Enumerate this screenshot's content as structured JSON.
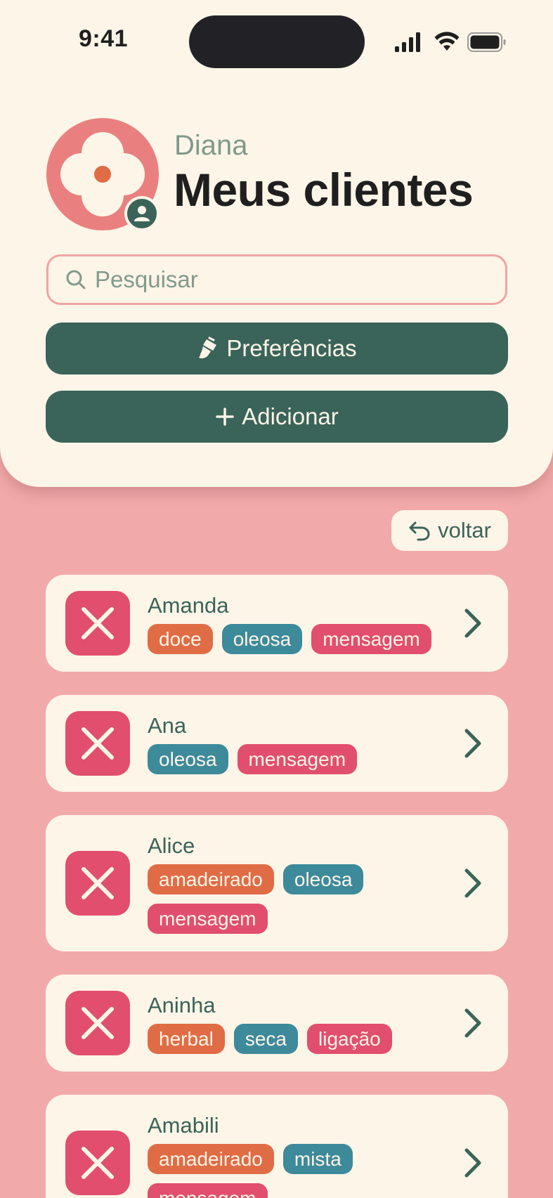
{
  "status_bar": {
    "time": "9:41"
  },
  "profile": {
    "user_name": "Diana"
  },
  "header": {
    "title": "Meus clientes"
  },
  "search": {
    "placeholder": "Pesquisar",
    "value": ""
  },
  "actions": {
    "preferences_label": "Preferências",
    "add_label": "Adicionar"
  },
  "back": {
    "label": "voltar"
  },
  "colors": {
    "background": "#F2A9AA",
    "card": "#FDF5E8",
    "primary": "#3A6459",
    "remove": "#E14E6E",
    "tag_orange": "#E06C45",
    "tag_teal": "#3D8A9B",
    "tag_pink": "#E14E6E",
    "avatar": "#E9807F"
  },
  "clients": [
    {
      "name": "Amanda",
      "tags": [
        {
          "label": "doce",
          "color": "#E06C45"
        },
        {
          "label": "oleosa",
          "color": "#3D8A9B"
        },
        {
          "label": "mensagem",
          "color": "#E14E6E"
        }
      ]
    },
    {
      "name": "Ana",
      "tags": [
        {
          "label": "oleosa",
          "color": "#3D8A9B"
        },
        {
          "label": "mensagem",
          "color": "#E14E6E"
        }
      ]
    },
    {
      "name": "Alice",
      "tags": [
        {
          "label": "amadeirado",
          "color": "#E06C45"
        },
        {
          "label": "oleosa",
          "color": "#3D8A9B"
        },
        {
          "label": "mensagem",
          "color": "#E14E6E"
        }
      ]
    },
    {
      "name": "Aninha",
      "tags": [
        {
          "label": "herbal",
          "color": "#E06C45"
        },
        {
          "label": "seca",
          "color": "#3D8A9B"
        },
        {
          "label": "ligação",
          "color": "#E14E6E"
        }
      ]
    },
    {
      "name": "Amabili",
      "tags": [
        {
          "label": "amadeirado",
          "color": "#E06C45"
        },
        {
          "label": "mista",
          "color": "#3D8A9B"
        },
        {
          "label": "mensagem",
          "color": "#E14E6E"
        }
      ]
    }
  ],
  "icons": {
    "remove": "close-icon",
    "open": "chevron-right-icon",
    "search": "search-icon",
    "preferences": "brush-icon",
    "add": "plus-icon",
    "back": "undo-arrow-icon",
    "avatar": "flower-icon",
    "avatar_badge": "user-icon"
  }
}
